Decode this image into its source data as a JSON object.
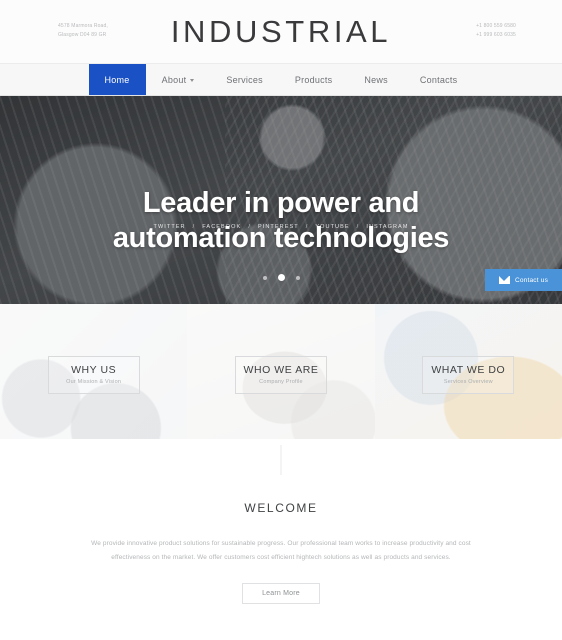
{
  "header": {
    "brand": "INDUSTRIAL",
    "address_line1": "4578 Marmora Road,",
    "address_line2": "Glasgow D04 89 GR",
    "phone1": "+1 800 559 6580",
    "phone2": "+1 999 603 6035"
  },
  "nav": {
    "items": [
      {
        "label": "Home",
        "active": true,
        "caret": false
      },
      {
        "label": "About",
        "active": false,
        "caret": true
      },
      {
        "label": "Services",
        "active": false,
        "caret": false
      },
      {
        "label": "Products",
        "active": false,
        "caret": false
      },
      {
        "label": "News",
        "active": false,
        "caret": false
      },
      {
        "label": "Contacts",
        "active": false,
        "caret": false
      }
    ],
    "active_color": "#1a51c4"
  },
  "hero": {
    "title_line1": "Leader in power and",
    "title_line2": "automation technologies",
    "social": [
      "TWITTER",
      "FACEBOOK",
      "PINTEREST",
      "YOUTUBE",
      "INSTAGRAM"
    ],
    "separator": "/",
    "slides": 3,
    "active_slide": 2
  },
  "contact_buttons": {
    "label": "Contact us",
    "icon": "envelope-icon",
    "color": "#4a93d9"
  },
  "panels": [
    {
      "title": "WHY US",
      "subtitle": "Our Mission & Vision"
    },
    {
      "title": "WHO WE ARE",
      "subtitle": "Company Profile"
    },
    {
      "title": "WHAT WE DO",
      "subtitle": "Services Overview"
    }
  ],
  "welcome": {
    "title": "WELCOME",
    "paragraph": "We provide innovative product solutions for sustainable progress. Our professional team works to increase productivity and cost effectiveness on the market. We offer customers cost efficient hightech solutions as well as products and services.",
    "button": "Learn More"
  }
}
